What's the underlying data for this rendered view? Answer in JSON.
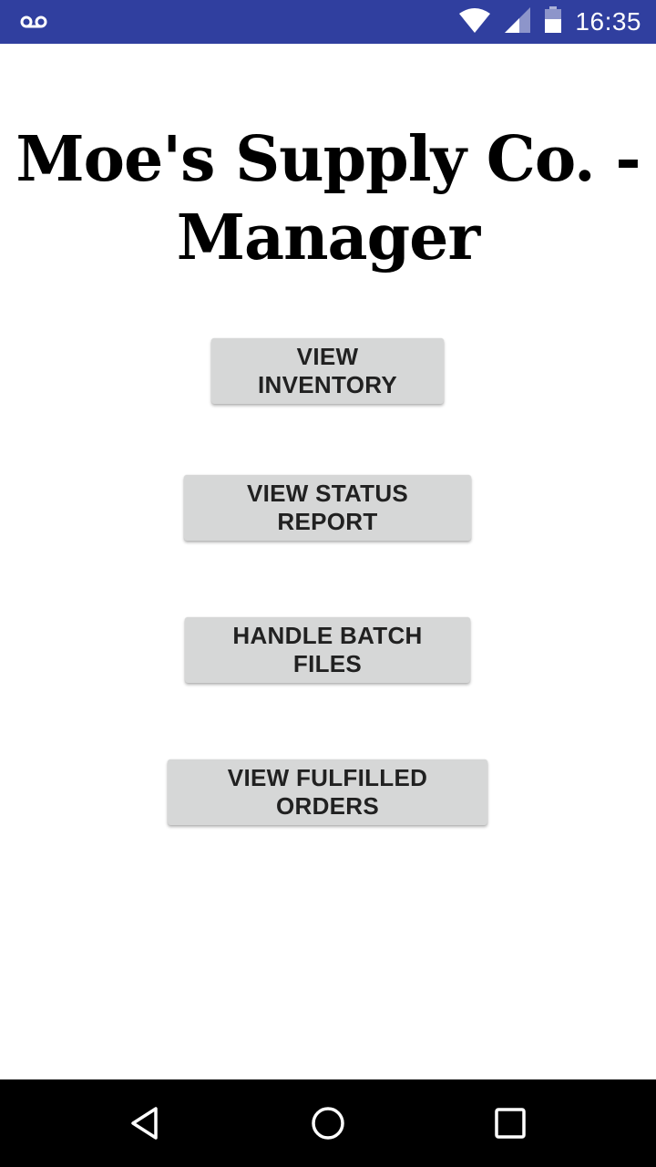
{
  "status_bar": {
    "time": "16:35",
    "icons": [
      "voicemail-icon",
      "wifi-icon",
      "cell-signal-icon",
      "battery-icon"
    ],
    "background_color": "#303F9F"
  },
  "main": {
    "title": "Moe's Supply Co. - Manager",
    "buttons": [
      {
        "label": "VIEW INVENTORY"
      },
      {
        "label": "VIEW STATUS REPORT"
      },
      {
        "label": "HANDLE BATCH FILES"
      },
      {
        "label": "VIEW FULFILLED ORDERS"
      }
    ],
    "button_color": "#d6d7d7"
  },
  "nav_bar": {
    "icons": [
      "back-icon",
      "home-icon",
      "recents-icon"
    ]
  }
}
